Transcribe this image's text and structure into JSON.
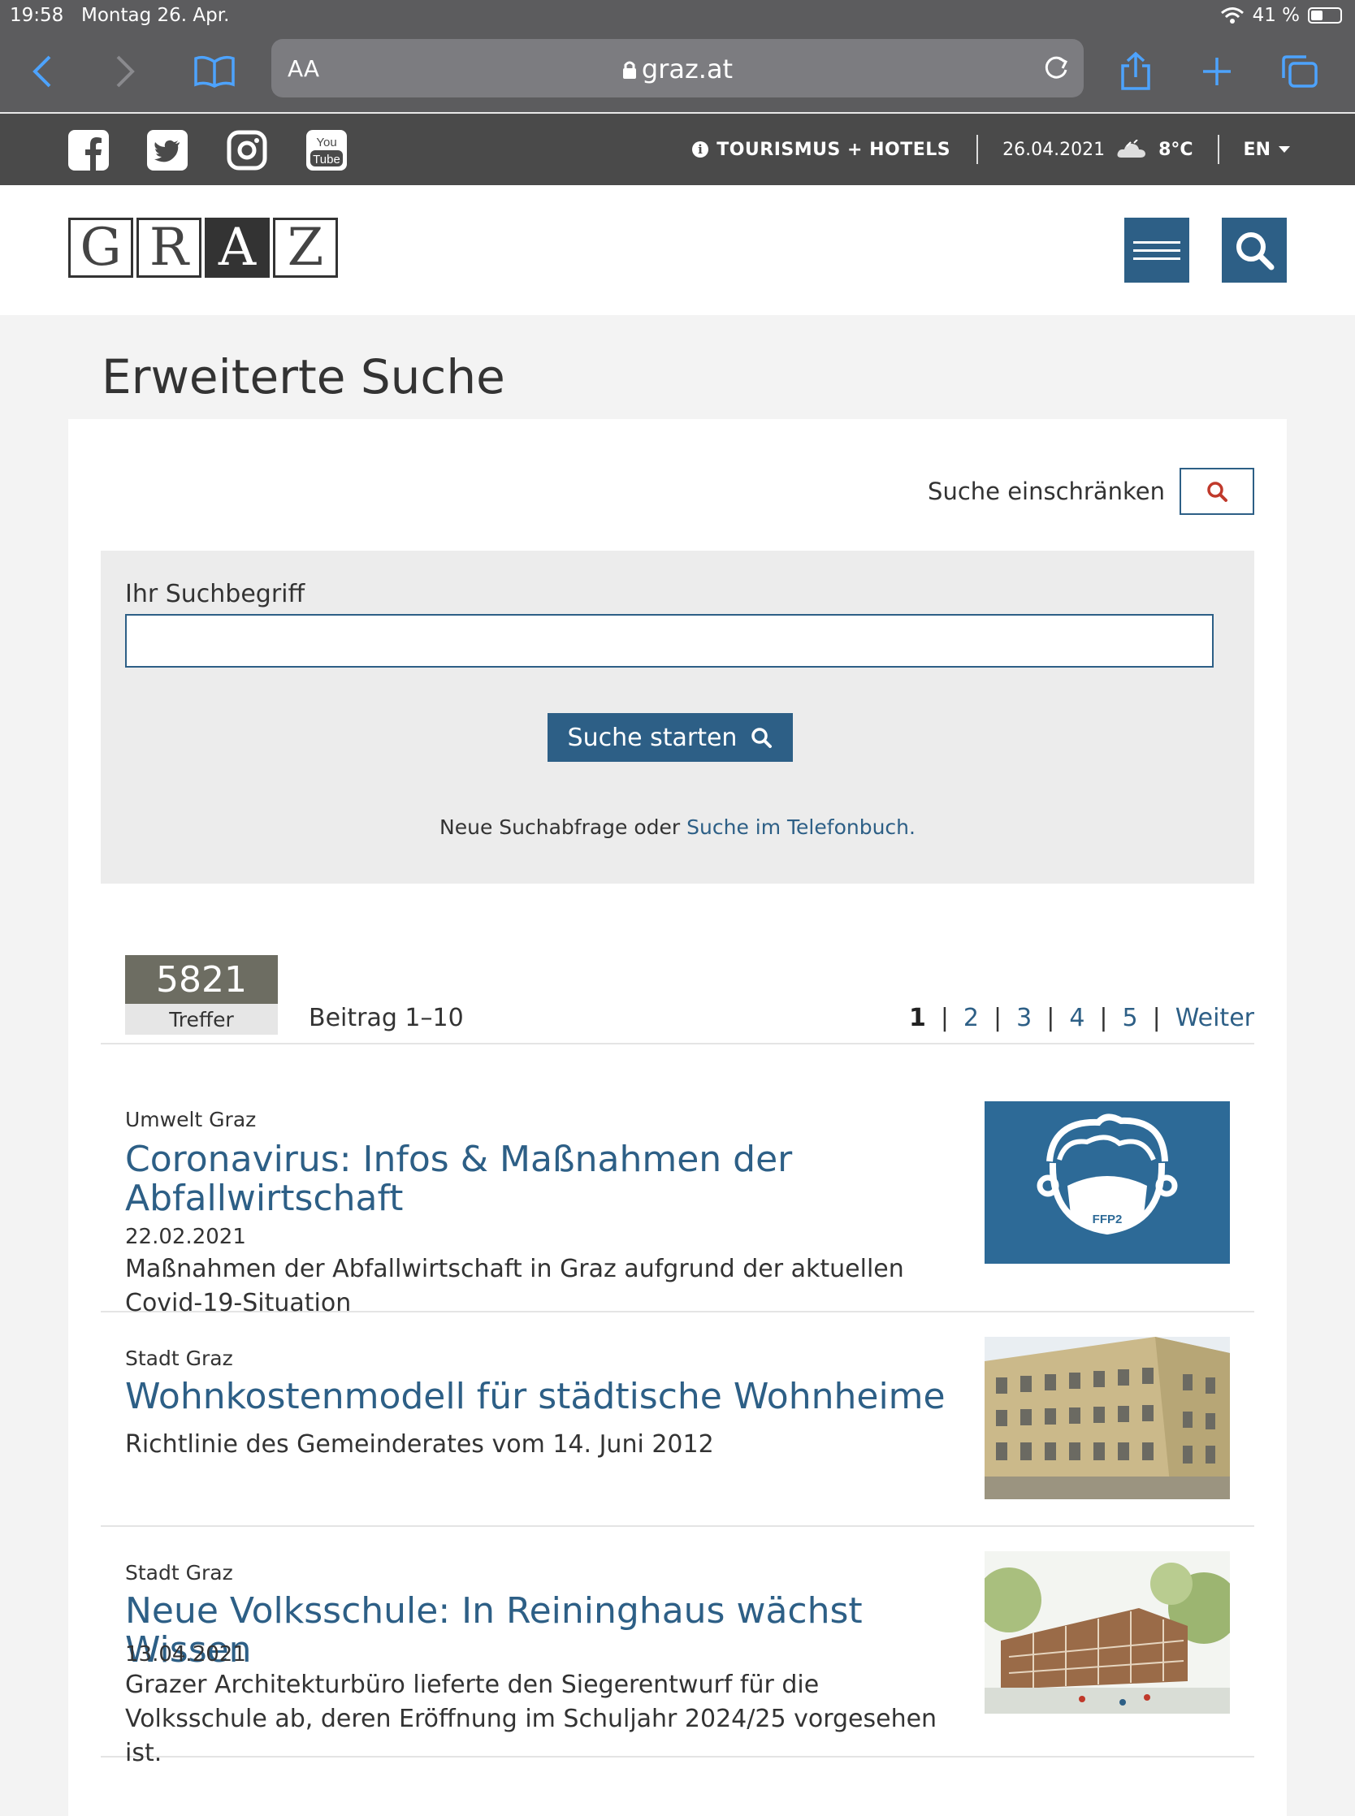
{
  "status_bar": {
    "time": "19:58",
    "date": "Montag 26. Apr.",
    "battery": "41 %"
  },
  "browser": {
    "text_size_label": "AA",
    "url": "graz.at"
  },
  "topbar": {
    "social": [
      "facebook-icon",
      "twitter-icon",
      "instagram-icon",
      "youtube-icon"
    ],
    "tourism_label": "TOURISMUS + HOTELS",
    "date": "26.04.2021",
    "temperature": "8°C",
    "language": "EN"
  },
  "header": {
    "logo_letters": [
      "G",
      "R",
      "A",
      "Z"
    ]
  },
  "page": {
    "title": "Erweiterte Suche",
    "refine_label": "Suche einschränken",
    "search_label": "Ihr Suchbegriff",
    "search_value": "",
    "submit_label": "Suche starten",
    "new_query_text": "Neue Suchabfrage oder",
    "phonebook_link": "Suche im Telefonbuch."
  },
  "results_meta": {
    "count": "5821",
    "count_label": "Treffer",
    "range": "Beitrag 1–10",
    "pages": [
      "1",
      "2",
      "3",
      "4",
      "5"
    ],
    "next_label": "Weiter"
  },
  "results": [
    {
      "category": "Umwelt Graz",
      "title": "Coronavirus: Infos & Maßnahmen der Abfallwirtschaft",
      "date": "22.02.2021",
      "description": "Maßnahmen der Abfallwirtschaft in Graz aufgrund der aktuellen Covid-19-Situation",
      "image_text": "FFP2"
    },
    {
      "category": "Stadt Graz",
      "title": "Wohnkostenmodell für städtische Wohnheime",
      "date": "",
      "description": "Richtlinie des Gemeinderates vom 14. Juni 2012"
    },
    {
      "category": "Stadt Graz",
      "title": "Neue Volksschule: In Reininghaus wächst Wissen",
      "date": "13.04.2021",
      "description": "Grazer Architekturbüro lieferte den Siegerentwurf für die Volksschule ab, deren Eröffnung im Schuljahr 2024/25 vorgesehen ist."
    }
  ],
  "colors": {
    "brand_blue": "#2d5f86",
    "topbar_gray": "#4a4a4a",
    "hits_gray": "#6d6d62"
  }
}
